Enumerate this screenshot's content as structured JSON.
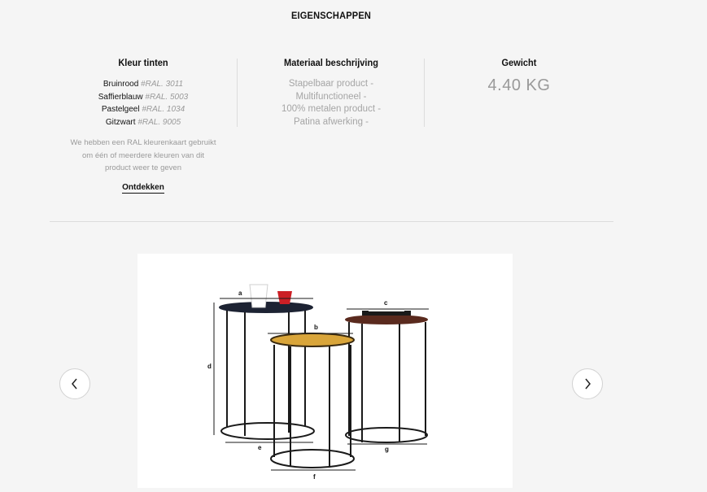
{
  "section": {
    "title": "EIGENSCHAPPEN"
  },
  "colors": {
    "heading": "Kleur tinten",
    "items": [
      {
        "name": "Bruinrood",
        "code": "#RAL. 3011"
      },
      {
        "name": "Saffierblauw",
        "code": "#RAL. 5003"
      },
      {
        "name": "Pastelgeel",
        "code": "#RAL. 1034"
      },
      {
        "name": "Gitzwart",
        "code": "#RAL. 9005"
      }
    ],
    "note": "We hebben een RAL kleurenkaart gebruikt om één of meerdere kleuren van dit product weer te geven",
    "link": "Ontdekken"
  },
  "material": {
    "heading": "Materiaal beschrijving",
    "items": [
      "Stapelbaar product -",
      "Multifunctioneel -",
      "100% metalen product -",
      "Patina afwerking -"
    ]
  },
  "weight": {
    "heading": "Gewicht",
    "value": "4.40 KG"
  },
  "product_image": {
    "dimension_labels": [
      "a",
      "b",
      "c",
      "d",
      "e",
      "f",
      "g"
    ],
    "colors": {
      "navy_top": "#1d2333",
      "mustard_top": "#d9a53a",
      "brown_top": "#5a2a1e",
      "frame": "#1a1a1a",
      "red_cup": "#cc1f25"
    }
  },
  "carousel": {
    "prev_icon": "chevron-left-icon",
    "next_icon": "chevron-right-icon"
  }
}
